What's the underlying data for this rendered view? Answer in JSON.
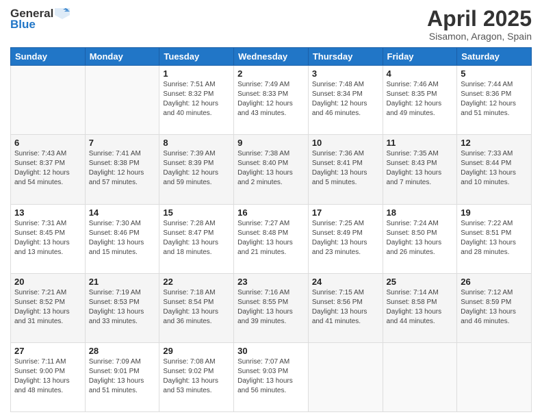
{
  "header": {
    "logo_line1": "General",
    "logo_line2": "Blue",
    "title": "April 2025",
    "subtitle": "Sisamon, Aragon, Spain"
  },
  "days_of_week": [
    "Sunday",
    "Monday",
    "Tuesday",
    "Wednesday",
    "Thursday",
    "Friday",
    "Saturday"
  ],
  "weeks": [
    [
      {
        "day": "",
        "info": ""
      },
      {
        "day": "",
        "info": ""
      },
      {
        "day": "1",
        "info": "Sunrise: 7:51 AM\nSunset: 8:32 PM\nDaylight: 12 hours and 40 minutes."
      },
      {
        "day": "2",
        "info": "Sunrise: 7:49 AM\nSunset: 8:33 PM\nDaylight: 12 hours and 43 minutes."
      },
      {
        "day": "3",
        "info": "Sunrise: 7:48 AM\nSunset: 8:34 PM\nDaylight: 12 hours and 46 minutes."
      },
      {
        "day": "4",
        "info": "Sunrise: 7:46 AM\nSunset: 8:35 PM\nDaylight: 12 hours and 49 minutes."
      },
      {
        "day": "5",
        "info": "Sunrise: 7:44 AM\nSunset: 8:36 PM\nDaylight: 12 hours and 51 minutes."
      }
    ],
    [
      {
        "day": "6",
        "info": "Sunrise: 7:43 AM\nSunset: 8:37 PM\nDaylight: 12 hours and 54 minutes."
      },
      {
        "day": "7",
        "info": "Sunrise: 7:41 AM\nSunset: 8:38 PM\nDaylight: 12 hours and 57 minutes."
      },
      {
        "day": "8",
        "info": "Sunrise: 7:39 AM\nSunset: 8:39 PM\nDaylight: 12 hours and 59 minutes."
      },
      {
        "day": "9",
        "info": "Sunrise: 7:38 AM\nSunset: 8:40 PM\nDaylight: 13 hours and 2 minutes."
      },
      {
        "day": "10",
        "info": "Sunrise: 7:36 AM\nSunset: 8:41 PM\nDaylight: 13 hours and 5 minutes."
      },
      {
        "day": "11",
        "info": "Sunrise: 7:35 AM\nSunset: 8:43 PM\nDaylight: 13 hours and 7 minutes."
      },
      {
        "day": "12",
        "info": "Sunrise: 7:33 AM\nSunset: 8:44 PM\nDaylight: 13 hours and 10 minutes."
      }
    ],
    [
      {
        "day": "13",
        "info": "Sunrise: 7:31 AM\nSunset: 8:45 PM\nDaylight: 13 hours and 13 minutes."
      },
      {
        "day": "14",
        "info": "Sunrise: 7:30 AM\nSunset: 8:46 PM\nDaylight: 13 hours and 15 minutes."
      },
      {
        "day": "15",
        "info": "Sunrise: 7:28 AM\nSunset: 8:47 PM\nDaylight: 13 hours and 18 minutes."
      },
      {
        "day": "16",
        "info": "Sunrise: 7:27 AM\nSunset: 8:48 PM\nDaylight: 13 hours and 21 minutes."
      },
      {
        "day": "17",
        "info": "Sunrise: 7:25 AM\nSunset: 8:49 PM\nDaylight: 13 hours and 23 minutes."
      },
      {
        "day": "18",
        "info": "Sunrise: 7:24 AM\nSunset: 8:50 PM\nDaylight: 13 hours and 26 minutes."
      },
      {
        "day": "19",
        "info": "Sunrise: 7:22 AM\nSunset: 8:51 PM\nDaylight: 13 hours and 28 minutes."
      }
    ],
    [
      {
        "day": "20",
        "info": "Sunrise: 7:21 AM\nSunset: 8:52 PM\nDaylight: 13 hours and 31 minutes."
      },
      {
        "day": "21",
        "info": "Sunrise: 7:19 AM\nSunset: 8:53 PM\nDaylight: 13 hours and 33 minutes."
      },
      {
        "day": "22",
        "info": "Sunrise: 7:18 AM\nSunset: 8:54 PM\nDaylight: 13 hours and 36 minutes."
      },
      {
        "day": "23",
        "info": "Sunrise: 7:16 AM\nSunset: 8:55 PM\nDaylight: 13 hours and 39 minutes."
      },
      {
        "day": "24",
        "info": "Sunrise: 7:15 AM\nSunset: 8:56 PM\nDaylight: 13 hours and 41 minutes."
      },
      {
        "day": "25",
        "info": "Sunrise: 7:14 AM\nSunset: 8:58 PM\nDaylight: 13 hours and 44 minutes."
      },
      {
        "day": "26",
        "info": "Sunrise: 7:12 AM\nSunset: 8:59 PM\nDaylight: 13 hours and 46 minutes."
      }
    ],
    [
      {
        "day": "27",
        "info": "Sunrise: 7:11 AM\nSunset: 9:00 PM\nDaylight: 13 hours and 48 minutes."
      },
      {
        "day": "28",
        "info": "Sunrise: 7:09 AM\nSunset: 9:01 PM\nDaylight: 13 hours and 51 minutes."
      },
      {
        "day": "29",
        "info": "Sunrise: 7:08 AM\nSunset: 9:02 PM\nDaylight: 13 hours and 53 minutes."
      },
      {
        "day": "30",
        "info": "Sunrise: 7:07 AM\nSunset: 9:03 PM\nDaylight: 13 hours and 56 minutes."
      },
      {
        "day": "",
        "info": ""
      },
      {
        "day": "",
        "info": ""
      },
      {
        "day": "",
        "info": ""
      }
    ]
  ]
}
